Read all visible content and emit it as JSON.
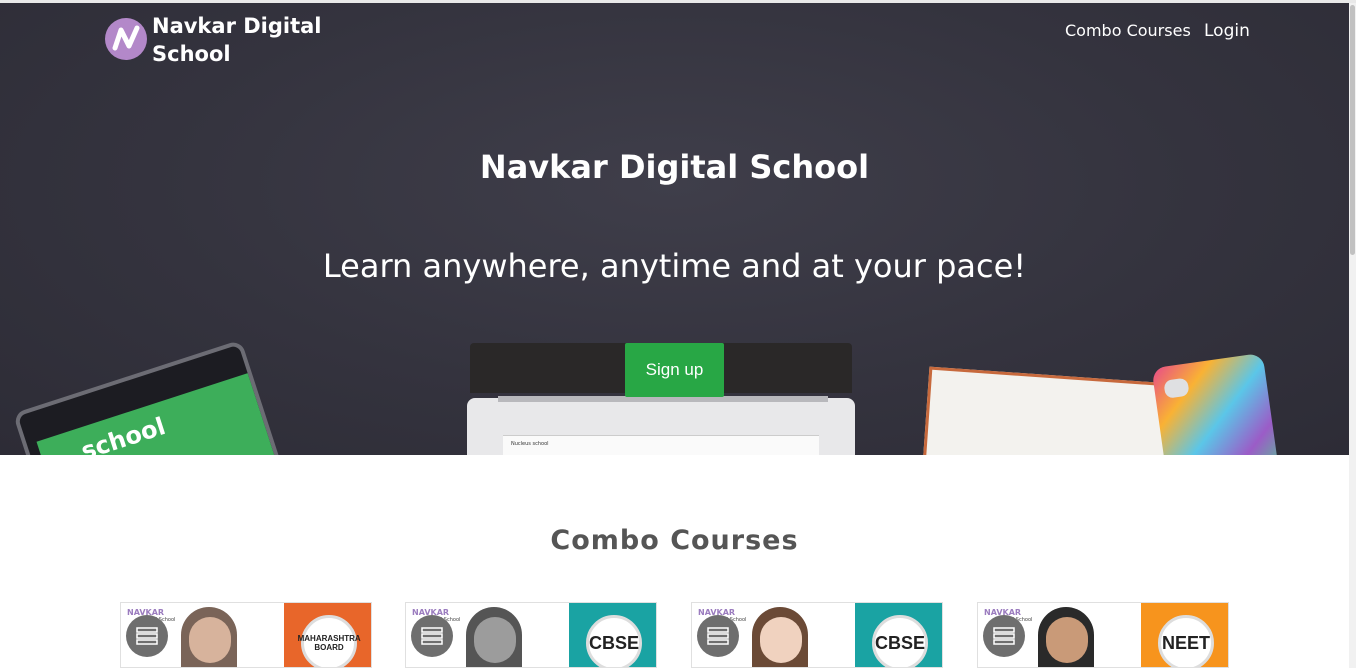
{
  "nav": {
    "brand_line1": "Navkar Digital",
    "brand_line2": "School",
    "links": [
      {
        "label": "Combo Courses"
      },
      {
        "label": "Login"
      }
    ]
  },
  "hero": {
    "title": "Navkar Digital School",
    "subtitle": "Learn anywhere, anytime and at your pace!",
    "signup_label": "Sign up",
    "tablet_text": "school",
    "laptop_text": "Nucleus school"
  },
  "section": {
    "title": "Combo Courses"
  },
  "cards": [
    {
      "logo": "NAVKAR",
      "logo_sub": "Digital School",
      "badge": "MAHARASHTRA BOARD",
      "color": "#e8662a"
    },
    {
      "logo": "NAVKAR",
      "logo_sub": "Digital School",
      "badge": "CBSE",
      "color": "#1aa3a3"
    },
    {
      "logo": "NAVKAR",
      "logo_sub": "Digital School",
      "badge": "CBSE",
      "color": "#1aa3a3"
    },
    {
      "logo": "NAVKAR",
      "logo_sub": "Digital School",
      "badge": "NEET",
      "color": "#f7941d"
    }
  ],
  "colors": {
    "accent_green": "#28a745",
    "hero_bg": "#34333e",
    "logo_purple": "#b388c9"
  },
  "icons": {
    "brand_logo": "navkar-n-logo",
    "course": "book-stack-icon"
  }
}
